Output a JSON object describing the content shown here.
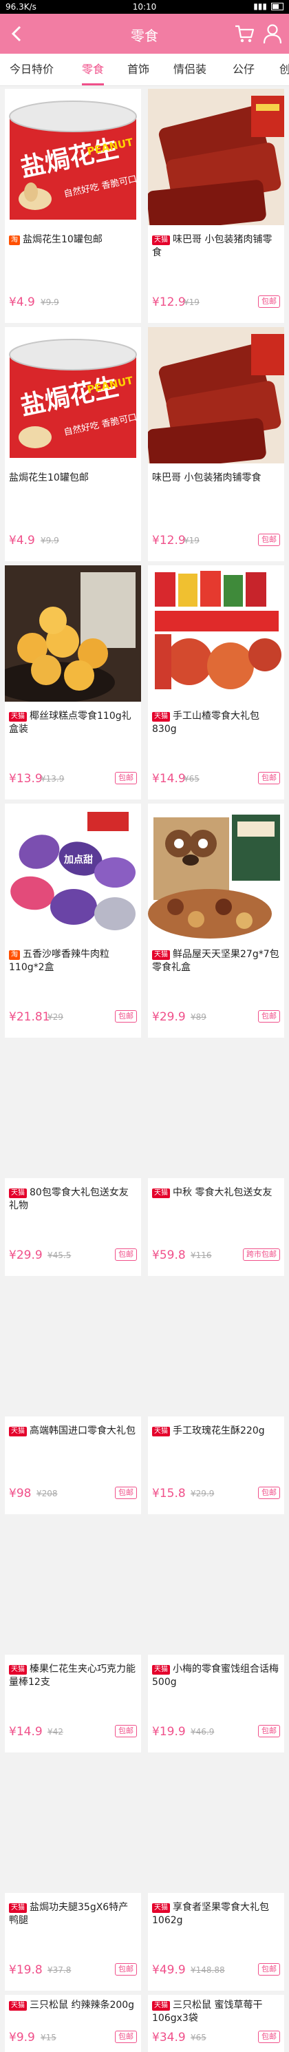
{
  "status": {
    "left": "96.3K/s",
    "time": "10:10"
  },
  "header": {
    "title": "零食"
  },
  "tabs": [
    {
      "label": "今日特价"
    },
    {
      "label": "零食",
      "active": true
    },
    {
      "label": "首饰"
    },
    {
      "label": "情侣装"
    },
    {
      "label": "公仔"
    },
    {
      "label": "创"
    }
  ],
  "colors": {
    "accent": "#f27da3",
    "price": "#f0508a",
    "tmall": "#e4002b",
    "taobao": "#ff5000"
  },
  "products": [
    {
      "badge": "淘",
      "name": "盐焗花生10罐包邮",
      "price": "¥4.9",
      "orig": "¥9.9",
      "ship": "",
      "img": "peanut"
    },
    {
      "badge": "天猫",
      "name": "味巴哥 小包装猪肉铺零食",
      "price": "¥12.9",
      "orig": "¥19",
      "ship": "包邮",
      "img": "jerky"
    },
    {
      "badge": "",
      "name": "盐焗花生10罐包邮",
      "price": "¥4.9",
      "orig": "¥9.9",
      "ship": "",
      "img": "peanut"
    },
    {
      "badge": "",
      "name": "味巴哥 小包装猪肉铺零食",
      "price": "¥12.9",
      "orig": "¥19",
      "ship": "包邮",
      "img": "jerky"
    },
    {
      "badge": "天猫",
      "name": "椰丝球糕点零食110g礼盒装",
      "price": "¥13.9",
      "orig": "¥13.9",
      "ship": "包邮",
      "img": "cakes"
    },
    {
      "badge": "天猫",
      "name": "手工山楂零食大礼包830g",
      "price": "¥14.9",
      "orig": "¥65",
      "ship": "包邮",
      "img": "snackpack"
    },
    {
      "badge": "淘",
      "name": "五香沙嗲香辣牛肉粒110g*2盒",
      "price": "¥21.81",
      "orig": "¥29",
      "ship": "包邮",
      "img": "candy"
    },
    {
      "badge": "天猫",
      "name": "鲜品屋天天坚果27g*7包零食礼盒",
      "price": "¥29.9",
      "orig": "¥89",
      "ship": "包邮",
      "img": "nuts"
    },
    {
      "badge": "天猫",
      "name": "80包零食大礼包送女友礼物",
      "price": "¥29.9",
      "orig": "¥45.5",
      "ship": "包邮",
      "img": ""
    },
    {
      "badge": "天猫",
      "name": "中秋 零食大礼包送女友",
      "price": "¥59.8",
      "orig": "¥116",
      "ship": "跨市包邮",
      "img": ""
    },
    {
      "badge": "天猫",
      "name": "高端韩国进口零食大礼包",
      "price": "¥98",
      "orig": "¥208",
      "ship": "包邮",
      "img": ""
    },
    {
      "badge": "天猫",
      "name": "手工玫瑰花生酥220g",
      "price": "¥15.8",
      "orig": "¥29.9",
      "ship": "包邮",
      "img": ""
    },
    {
      "badge": "天猫",
      "name": "榛果仁花生夹心巧克力能量棒12支",
      "price": "¥14.9",
      "orig": "¥42",
      "ship": "包邮",
      "img": ""
    },
    {
      "badge": "天猫",
      "name": "小梅的零食蜜饯组合话梅500g",
      "price": "¥19.9",
      "orig": "¥46.9",
      "ship": "包邮",
      "img": ""
    },
    {
      "badge": "天猫",
      "name": "盐焗功夫腿35gX6特产鸭腿",
      "price": "¥19.8",
      "orig": "¥37.8",
      "ship": "包邮",
      "img": ""
    },
    {
      "badge": "天猫",
      "name": "享食者坚果零食大礼包1062g",
      "price": "¥49.9",
      "orig": "¥148.88",
      "ship": "包邮",
      "img": ""
    },
    {
      "badge": "天猫",
      "name": "三只松鼠 约辣辣条200g",
      "price": "¥9.9",
      "orig": "¥15",
      "ship": "包邮",
      "img": ""
    },
    {
      "badge": "天猫",
      "name": "三只松鼠 蜜饯草莓干106gx3袋",
      "price": "¥34.9",
      "orig": "¥65",
      "ship": "包邮",
      "img": ""
    }
  ],
  "imgtext": {
    "peanut_brand": "盐焗花生",
    "peanut_en": "PEANUT",
    "peanut_slogan": "自然好吃 香脆可口",
    "candy_brand": "加点甜"
  }
}
